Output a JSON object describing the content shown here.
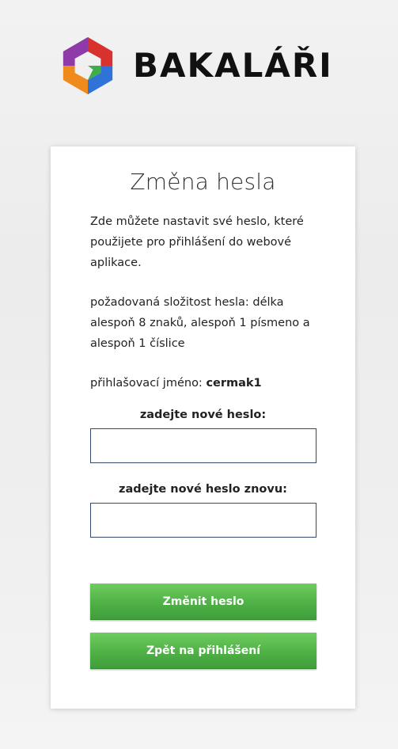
{
  "brand": {
    "name": "BAKALÁŘI",
    "logo_icon": "bakalari-logo-icon",
    "colors": {
      "purple": "#8e3aa8",
      "red": "#d8322e",
      "orange": "#ef8a1d",
      "blue": "#2f72d8",
      "green": "#3fae4a"
    }
  },
  "card": {
    "title": "Změna hesla",
    "intro": "Zde můžete nastavit své heslo, které použijete pro přihlášení do webové aplikace.",
    "complexity": "požadovaná složitost hesla: délka alespoň 8 znaků, alespoň 1 písmeno a alespoň 1 číslice",
    "login_label": "přihlašovací jméno:",
    "login_name": "cermak1"
  },
  "form": {
    "new_password_label": "zadejte nové heslo:",
    "new_password_value": "",
    "confirm_password_label": "zadejte nové heslo znovu:",
    "confirm_password_value": ""
  },
  "buttons": {
    "change_label": "Změnit heslo",
    "back_label": "Zpět na přihlášení",
    "color": "#4eb045"
  }
}
